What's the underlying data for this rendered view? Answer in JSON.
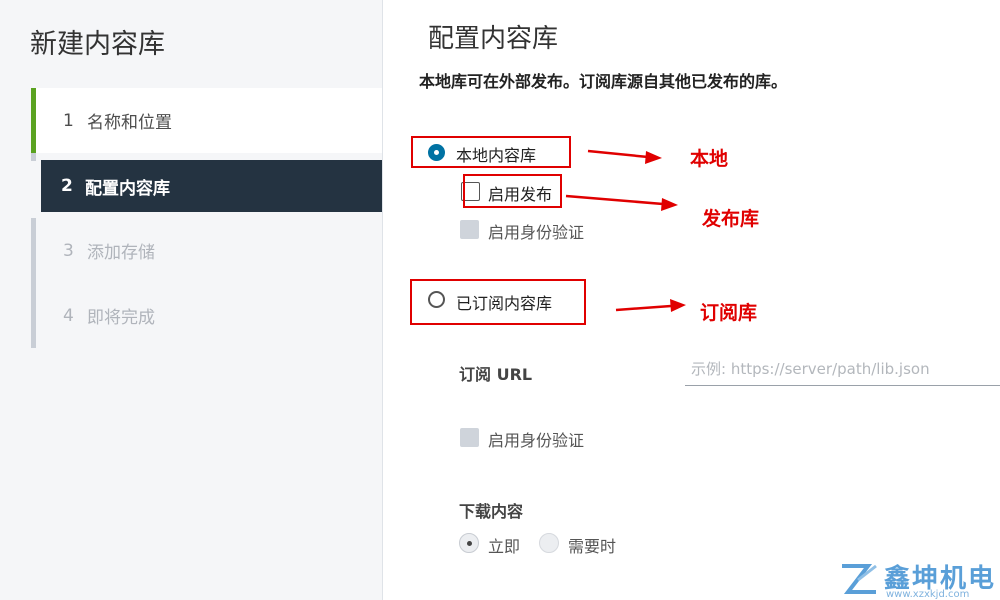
{
  "wizard": {
    "title": "新建内容库",
    "steps": [
      {
        "num": "1",
        "label": "名称和位置",
        "state": "completed"
      },
      {
        "num": "2",
        "label": "配置内容库",
        "state": "active"
      },
      {
        "num": "3",
        "label": "添加存储",
        "state": "pending"
      },
      {
        "num": "4",
        "label": "即将完成",
        "state": "pending"
      }
    ]
  },
  "page": {
    "title": "配置内容库",
    "description": "本地库可在外部发布。订阅库源自其他已发布的库。",
    "local_library": {
      "label": "本地内容库",
      "selected": true
    },
    "enable_publish": {
      "label": "启用发布",
      "checked": false
    },
    "enable_auth_local": {
      "label": "启用身份验证",
      "checked": false,
      "disabled": true
    },
    "subscribed_library": {
      "label": "已订阅内容库",
      "selected": false
    },
    "subscription_url": {
      "label": "订阅 URL",
      "value": "",
      "placeholder": "示例: https://server/path/lib.json"
    },
    "enable_auth_subscribed": {
      "label": "启用身份验证",
      "checked": false,
      "disabled": true
    },
    "download_content": {
      "label": "下载内容",
      "options": [
        {
          "label": "立即",
          "selected": true
        },
        {
          "label": "需要时",
          "selected": false
        }
      ]
    }
  },
  "annotations": {
    "local": "本地",
    "publish": "发布库",
    "subscribed": "订阅库",
    "color": "#e00000"
  },
  "watermark": {
    "brand": "鑫坤机电",
    "url": "www.xzxkjd.com"
  },
  "colors": {
    "accent": "#0072a3",
    "active_step_bg": "#243341",
    "completed_step_bar": "#5aa220"
  }
}
